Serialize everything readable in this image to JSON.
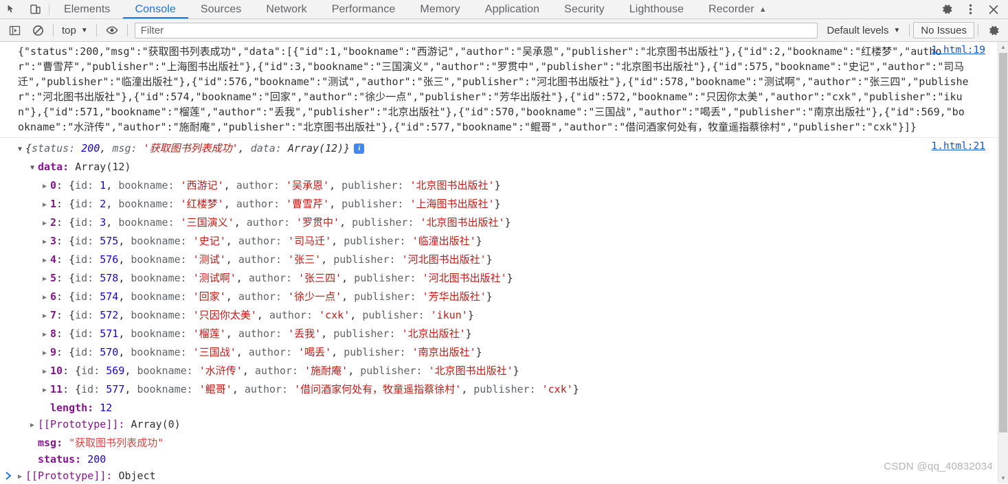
{
  "devtools": {
    "left_icons": [
      {
        "name": "inspect-element-icon",
        "label": "Inspect element"
      },
      {
        "name": "device-toolbar-icon",
        "label": "Toggle device toolbar"
      }
    ],
    "tabs": [
      {
        "label": "Elements",
        "active": false
      },
      {
        "label": "Console",
        "active": true
      },
      {
        "label": "Sources",
        "active": false
      },
      {
        "label": "Network",
        "active": false
      },
      {
        "label": "Performance",
        "active": false
      },
      {
        "label": "Memory",
        "active": false
      },
      {
        "label": "Application",
        "active": false
      },
      {
        "label": "Security",
        "active": false
      },
      {
        "label": "Lighthouse",
        "active": false
      },
      {
        "label": "Recorder",
        "active": false,
        "caret": "▲"
      }
    ],
    "right_icons": [
      {
        "name": "settings-gear-icon",
        "label": "Settings"
      },
      {
        "name": "more-options-icon",
        "label": "Customize and control DevTools"
      },
      {
        "name": "close-devtools-icon",
        "label": "Close"
      }
    ],
    "accent_color": "#1a73e8",
    "toolbar_bg": "#f3f3f3"
  },
  "console_toolbar": {
    "sidebar_toggle": "Show console sidebar",
    "clear_console": "Clear console",
    "context_selector": "top",
    "context_caret": "▼",
    "live_expression": "Create live expression",
    "filter_placeholder": "Filter",
    "filter_value": "",
    "levels_label": "Default levels",
    "levels_caret": "▼",
    "issues_label": "No Issues",
    "settings_label": "Console settings"
  },
  "messages": [
    {
      "type": "raw-json",
      "source_link": "1.html:19",
      "text": "{\"status\":200,\"msg\":\"获取图书列表成功\",\"data\":[{\"id\":1,\"bookname\":\"西游记\",\"author\":\"吴承恩\",\"publisher\":\"北京图书出版社\"},{\"id\":2,\"bookname\":\"红楼梦\",\"author\":\"曹雪芹\",\"publisher\":\"上海图书出版社\"},{\"id\":3,\"bookname\":\"三国演义\",\"author\":\"罗贯中\",\"publisher\":\"北京图书出版社\"},{\"id\":575,\"bookname\":\"史记\",\"author\":\"司马迁\",\"publisher\":\"临潼出版社\"},{\"id\":576,\"bookname\":\"测试\",\"author\":\"张三\",\"publisher\":\"河北图书出版社\"},{\"id\":578,\"bookname\":\"测试啊\",\"author\":\"张三四\",\"publisher\":\"河北图书出版社\"},{\"id\":574,\"bookname\":\"回家\",\"author\":\"徐少一点\",\"publisher\":\"芳华出版社\"},{\"id\":572,\"bookname\":\"只因你太美\",\"author\":\"cxk\",\"publisher\":\"ikun\"},{\"id\":571,\"bookname\":\"榴莲\",\"author\":\"丢我\",\"publisher\":\"北京出版社\"},{\"id\":570,\"bookname\":\"三国战\",\"author\":\"喝丢\",\"publisher\":\"南京出版社\"},{\"id\":569,\"bookname\":\"水浒传\",\"author\":\"施耐庵\",\"publisher\":\"北京图书出版社\"},{\"id\":577,\"bookname\":\"鲲哥\",\"author\":\"借问酒家何处有，牧童遥指蔡徐村\",\"publisher\":\"cxk\"}]}"
    },
    {
      "type": "object-tree",
      "source_link": "1.html:21",
      "preview": {
        "open": "{",
        "k1": "status:",
        "v1": "200",
        "sep1": ",",
        "k2": "msg:",
        "v2": "'获取图书列表成功'",
        "sep2": ",",
        "k3": "data:",
        "v3": "Array(12)",
        "close": "}"
      },
      "data_label": "data:",
      "data_value": "Array(12)",
      "items": [
        {
          "index": "0",
          "id": "1",
          "bookname": "'西游记'",
          "author": "'吴承恩'",
          "publisher": "'北京图书出版社'"
        },
        {
          "index": "1",
          "id": "2",
          "bookname": "'红楼梦'",
          "author": "'曹雪芹'",
          "publisher": "'上海图书出版社'"
        },
        {
          "index": "2",
          "id": "3",
          "bookname": "'三国演义'",
          "author": "'罗贯中'",
          "publisher": "'北京图书出版社'"
        },
        {
          "index": "3",
          "id": "575",
          "bookname": "'史记'",
          "author": "'司马迁'",
          "publisher": "'临潼出版社'"
        },
        {
          "index": "4",
          "id": "576",
          "bookname": "'测试'",
          "author": "'张三'",
          "publisher": "'河北图书出版社'"
        },
        {
          "index": "5",
          "id": "578",
          "bookname": "'测试啊'",
          "author": "'张三四'",
          "publisher": "'河北图书出版社'"
        },
        {
          "index": "6",
          "id": "574",
          "bookname": "'回家'",
          "author": "'徐少一点'",
          "publisher": "'芳华出版社'"
        },
        {
          "index": "7",
          "id": "572",
          "bookname": "'只因你太美'",
          "author": "'cxk'",
          "publisher": "'ikun'"
        },
        {
          "index": "8",
          "id": "571",
          "bookname": "'榴莲'",
          "author": "'丢我'",
          "publisher": "'北京出版社'"
        },
        {
          "index": "9",
          "id": "570",
          "bookname": "'三国战'",
          "author": "'喝丢'",
          "publisher": "'南京出版社'"
        },
        {
          "index": "10",
          "id": "569",
          "bookname": "'水浒传'",
          "author": "'施耐庵'",
          "publisher": "'北京图书出版社'"
        },
        {
          "index": "11",
          "id": "577",
          "bookname": "'鲲哥'",
          "author": "'借问酒家何处有，牧童遥指蔡徐村'",
          "publisher": "'cxk'"
        }
      ],
      "length_label": "length:",
      "length_value": "12",
      "array_proto_label": "[[Prototype]]:",
      "array_proto_value": "Array(0)",
      "msg_label": "msg:",
      "msg_value": "\"获取图书列表成功\"",
      "status_label": "status:",
      "status_value": "200",
      "obj_proto_label": "[[Prototype]]:",
      "obj_proto_value": "Object"
    }
  ],
  "labels": {
    "key_id": "id:",
    "key_bookname": "bookname:",
    "key_author": "author:",
    "key_publisher": "publisher:",
    "brace_open": "{",
    "brace_close": "}",
    "comma": ",",
    "colon": ":",
    "arrow_collapsed": "▶",
    "arrow_expanded": "▼",
    "info_badge": "i"
  },
  "watermark": "CSDN @qq_40832034",
  "colors": {
    "string": "#c41a16",
    "number": "#1c00cf",
    "key": "#881391",
    "link": "#1155cc",
    "accent": "#1a73e8"
  }
}
